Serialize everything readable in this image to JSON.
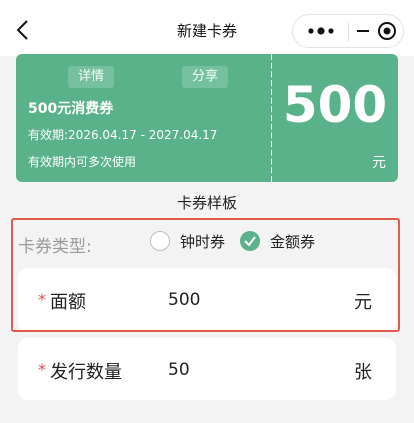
{
  "nav": {
    "title": "新建卡券",
    "back_icon": "back-chevron-icon",
    "more_icon": "more-dots-icon",
    "close_icon": "target-close-icon"
  },
  "coupon": {
    "detail_label": "详情",
    "share_label": "分享",
    "name": "500元消费券",
    "validity": "有效期:2026.04.17 - 2027.04.17",
    "multi_use": "有效期内可多次使用",
    "amount": "500",
    "unit": "元",
    "color": "#5ab28a"
  },
  "sample_title": "卡券样板",
  "form": {
    "type_label": "卡券类型:",
    "options": [
      {
        "label": "钟时券",
        "selected": false
      },
      {
        "label": "金额券",
        "selected": true
      }
    ],
    "face_value": {
      "label": "面额",
      "value": "500",
      "unit": "元",
      "required": "*"
    },
    "quantity": {
      "label": "发行数量",
      "value": "50",
      "unit": "张",
      "required": "*"
    }
  },
  "colors": {
    "accent": "#5ab28a",
    "highlight": "#e05a4e",
    "required": "#d9534f"
  }
}
